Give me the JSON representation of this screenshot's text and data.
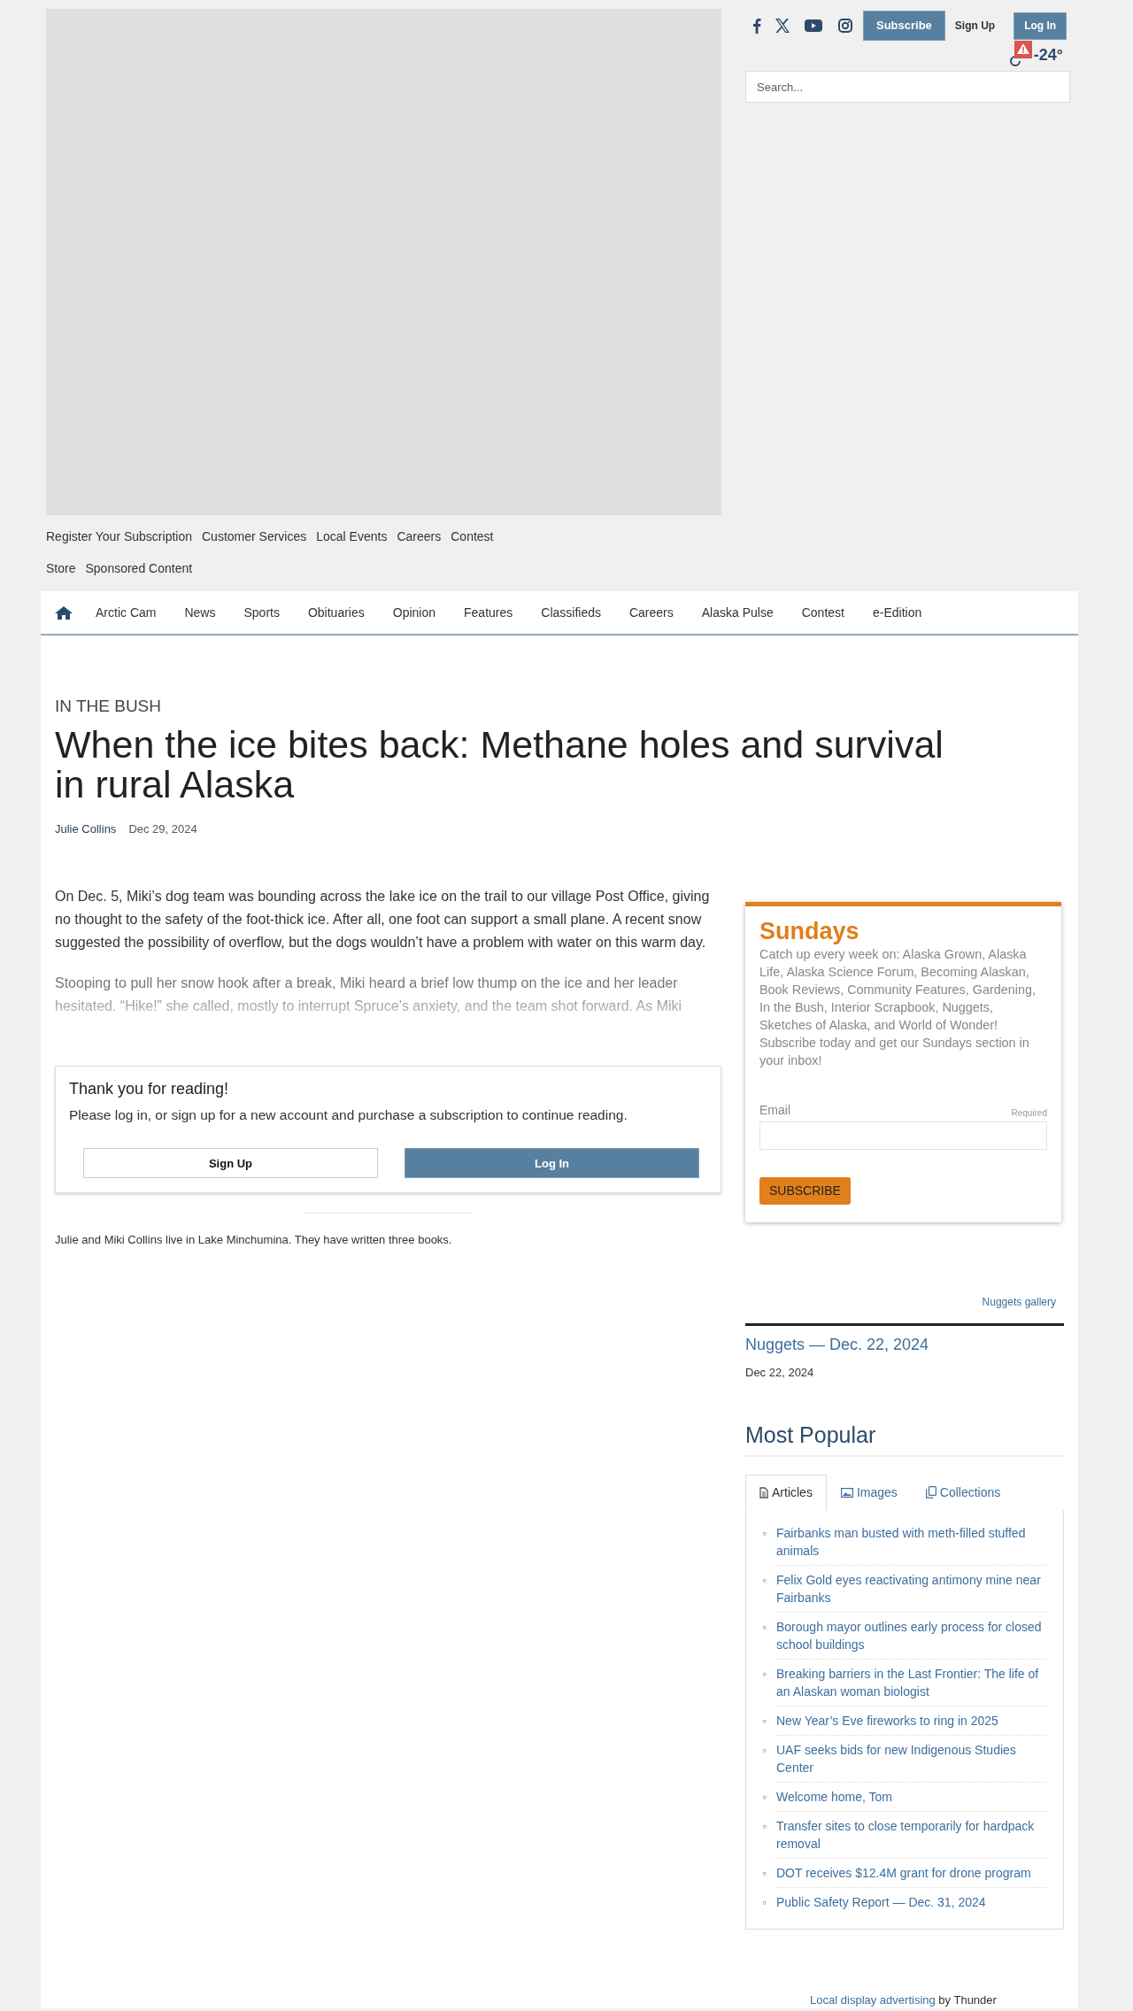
{
  "header": {
    "subscribe_button": "Subscribe",
    "signup_link": "Sign Up",
    "login_button": "Log In",
    "weather": {
      "alert": true,
      "temperature": "-24°"
    },
    "search": {
      "placeholder": "Search..."
    }
  },
  "utility_links": [
    [
      "Register Your Subscription",
      "Customer Services",
      "Local Events",
      "Careers",
      "Contest"
    ],
    [
      "Store",
      "Sponsored Content"
    ]
  ],
  "nav": {
    "items": [
      "Arctic Cam",
      "News",
      "Sports",
      "Obituaries",
      "Opinion",
      "Features",
      "Classifieds",
      "Careers",
      "Alaska Pulse",
      "Contest",
      "e-Edition"
    ]
  },
  "article": {
    "section": "IN THE BUSH",
    "title": "When the ice bites back: Methane holes and survival in rural Alaska",
    "author": "Julie Collins",
    "date": "Dec 29, 2024",
    "paragraphs": [
      {
        "text": "On Dec. 5, Miki’s dog team was bounding across the lake ice on the trail to our village Post Office, giving no thought to the safety of the foot-thick ice. After all, one foot can support a small plane. A recent snow suggested the possibility of overflow, but the dogs wouldn’t have a problem with water on this warm day.",
        "faded": false
      },
      {
        "text": "Stooping to pull her snow hook after a break, Miki heard a brief low thump on the ice and her leader hesitated. “Hike!” she called, mostly to interrupt Spruce’s anxiety, and the team shot forward. As Miki",
        "faded": true
      }
    ]
  },
  "paywall": {
    "title": "Thank you for reading!",
    "message": "Please log in, or sign up for a new account and purchase a subscription to continue reading.",
    "signup_button": "Sign Up",
    "login_button": "Log In"
  },
  "bio": "Julie and Miki Collins live in Lake Minchumina. They have written three books.",
  "newsletter": {
    "title": "Sundays",
    "description": "Catch up every week on: Alaska Grown, Alaska Life, Alaska Science Forum, Becoming Alaskan, Book Reviews, Community Features, Gardening, In the Bush, Interior Scrapbook, Nuggets, Sketches of Alaska, and World of Wonder! Subscribe today and get our Sundays section in your inbox!",
    "email_label": "Email",
    "required_label": "Required",
    "button": "SUBSCRIBE"
  },
  "nuggets": {
    "gallery_link": "Nuggets gallery",
    "title": "Nuggets — Dec. 22, 2024",
    "date": "Dec 22, 2024"
  },
  "most_popular": {
    "title": "Most Popular",
    "tabs": [
      {
        "label": "Articles",
        "kind": "document",
        "selected": true
      },
      {
        "label": "Images",
        "kind": "image",
        "selected": false
      },
      {
        "label": "Collections",
        "kind": "copies",
        "selected": false
      }
    ],
    "bullet": "◦",
    "articles": [
      "Fairbanks man busted with meth-filled stuffed animals",
      "Felix Gold eyes reactivating antimony mine near Fairbanks",
      "Borough mayor outlines early process for closed school buildings",
      "Breaking barriers in the Last Frontier: The life of an Alaskan woman biologist",
      "New Year’s Eve fireworks to ring in 2025",
      "UAF seeks bids for new Indigenous Studies Center",
      "Welcome home, Tom",
      "Transfer sites to close temporarily for hardpack removal",
      "DOT receives $12.4M grant for drone program",
      "Public Safety Report — Dec. 31, 2024"
    ]
  },
  "footer": {
    "link": "Local display advertising",
    "text": "by Thunder"
  }
}
